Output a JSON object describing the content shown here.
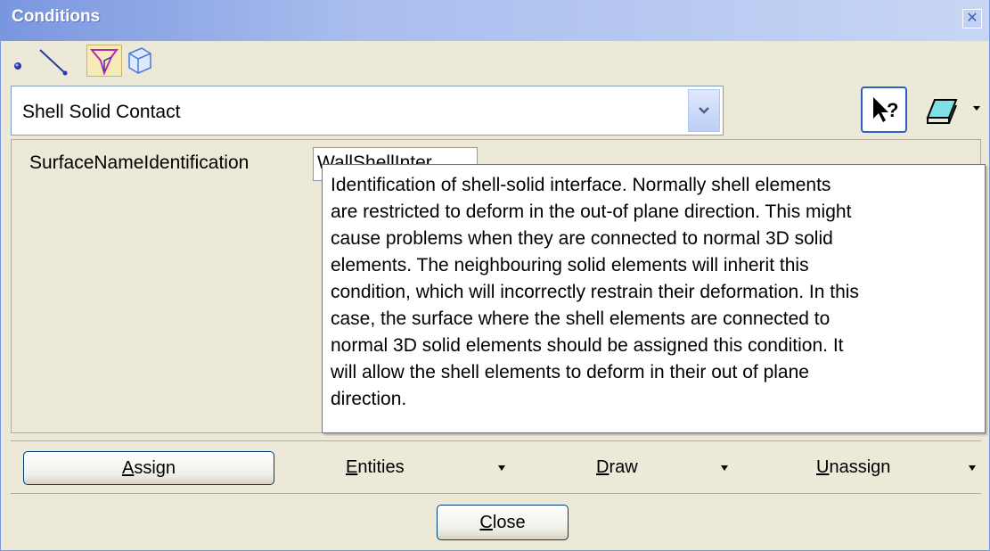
{
  "window": {
    "title": "Conditions"
  },
  "entity_types": [
    {
      "name": "point-icon",
      "selected": false
    },
    {
      "name": "line-icon",
      "selected": false
    },
    {
      "name": "surface-icon",
      "selected": true
    },
    {
      "name": "volume-icon",
      "selected": false
    }
  ],
  "condition_select": {
    "value": "Shell Solid Contact"
  },
  "property": {
    "label": "SurfaceNameIdentification",
    "value": "WallShellInter"
  },
  "tooltip": {
    "text": "Identification of shell-solid interface. Normally shell elements\nare restricted to deform in the out-of plane direction. This might\ncause problems when they are connected to normal 3D solid\nelements. The neighbouring solid elements will inherit this\ncondition, which will incorrectly restrain their deformation. In this\ncase, the surface where the shell elements are connected to\nnormal 3D solid elements should be assigned this condition. It\nwill allow the shell elements to deform in their out of plane\ndirection."
  },
  "actions": {
    "assign": {
      "mnemonic": "A",
      "rest": "ssign"
    },
    "entities": {
      "mnemonic": "E",
      "rest": "ntities"
    },
    "draw": {
      "mnemonic": "D",
      "rest": "raw"
    },
    "unassign": {
      "mnemonic": "U",
      "rest": "nassign"
    },
    "close": {
      "mnemonic": "C",
      "rest": "lose"
    }
  },
  "colors": {
    "titlebar_start": "#7a96df",
    "dialog_bg": "#ece9d8",
    "button_border": "#003c74",
    "accent_blue": "#2f5fc0"
  }
}
